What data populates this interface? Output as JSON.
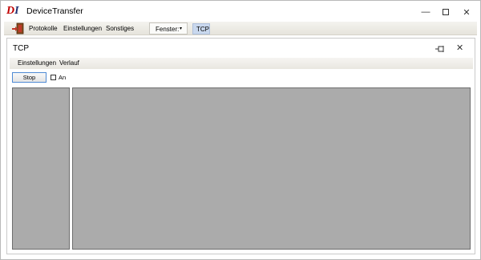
{
  "app": {
    "title": "DeviceTransfer",
    "logo_text_d": "D",
    "logo_text_i": "I"
  },
  "window_controls": {
    "minimize": "—",
    "close": "✕"
  },
  "menubar": {
    "items": [
      "Protokolle",
      "Einstellungen",
      "Sonstiges"
    ],
    "fenster_label": "Fenster:",
    "fenster_caret": "▾",
    "active_tab": "TCP"
  },
  "child_window": {
    "title": "TCP",
    "close": "✕",
    "submenu": [
      "Einstellungen",
      "Verlauf"
    ],
    "stop_button": "Stop",
    "checkbox_label": "An",
    "checkbox_checked": false
  },
  "colors": {
    "logo_d": "#c00000",
    "logo_i": "#1f2f6f",
    "panel_bg": "#ababab",
    "tab_bg": "#c9d8ee",
    "button_border": "#4f8ad4"
  },
  "icons": [
    "exit-door-icon",
    "pin-icon",
    "close-icon",
    "minimize-icon",
    "maximize-icon"
  ]
}
